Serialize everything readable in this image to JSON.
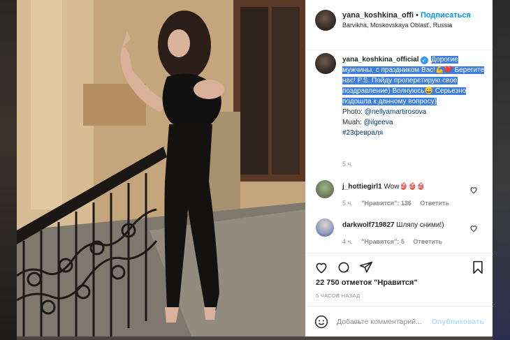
{
  "header": {
    "username": "yana_koshkina_offi",
    "separator": "•",
    "follow_label": "Подписаться",
    "location": "Barvikha, Moskovskaya Oblast', Russia"
  },
  "caption": {
    "username": "yana_koshkina_official",
    "verified_glyph": "✓",
    "highlighted_text": "Дорогие мужчины, с праздником Вас!💪❤️ Берегите нас! P.S. Пойду проперетирую своё поздравление) Волнуюсь😀 Серьезно подошла к данному вопросу)",
    "photo_credit": "Photo: ",
    "photo_handle": "@nellyamartirosova",
    "muah_credit": "Muah: ",
    "muah_handle": "@ilgeeva",
    "hashtag": "#23февраля",
    "time": "5 ч."
  },
  "comments": [
    {
      "username": "j_hottiegirl1",
      "text": "Wow👙👙👙",
      "time": "5 ч.",
      "likes": "\"Нравится\": 136",
      "reply": "Ответить"
    },
    {
      "username": "darkwolf719827",
      "text": "Шляпу сними!)",
      "time": "4 ч.",
      "likes": "\"Нравится\": 5",
      "reply": "Ответить"
    }
  ],
  "actions": {
    "icons": [
      "heart-icon",
      "comment-icon",
      "share-icon",
      "bookmark-icon"
    ]
  },
  "likes_text": "22 750 отметок \"Нравится\"",
  "time_ago": "5 ЧАСОВ НАЗАД",
  "add_comment": {
    "placeholder": "Добавьте комментарий...",
    "post_label": "Опубликовать"
  },
  "colors": {
    "accent": "#0095f6",
    "highlight": "#3d7fe0",
    "muted": "#8e8e8e"
  }
}
